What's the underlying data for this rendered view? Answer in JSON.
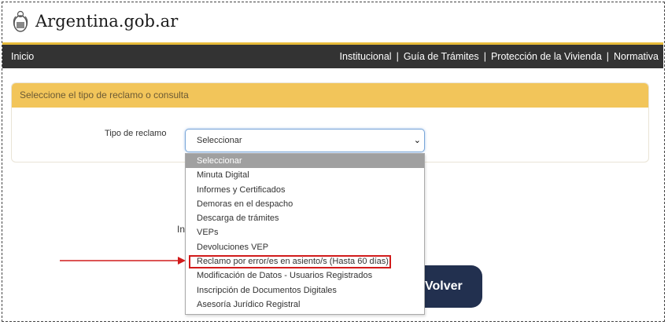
{
  "header": {
    "title": "Argentina.gob.ar",
    "logo_icon": "argentina-coat-of-arms-icon"
  },
  "nav": {
    "home": "Inicio",
    "items": [
      {
        "label": "Institucional"
      },
      {
        "label": "Guía de Trámites"
      },
      {
        "label": "Protección de la Vivienda"
      },
      {
        "label": "Normativa"
      }
    ],
    "separator": "|"
  },
  "panel": {
    "title": "Seleccione el tipo de reclamo o consulta"
  },
  "form": {
    "label": "Tipo de reclamo",
    "selected_value": "Seleccionar",
    "options": [
      "Seleccionar",
      "Minuta Digital",
      "Informes y Certificados",
      "Demoras en el despacho",
      "Descarga de trámites",
      "VEPs",
      "Devoluciones VEP",
      "Reclamo por error/es en asiento/s (Hasta 60 días)",
      "Modificación de Datos - Usuarios Registrados",
      "Inscripción de Documentos Digitales",
      "Asesoría Jurídico Registral"
    ],
    "highlighted_option_index": 7
  },
  "partial_text": "In",
  "back_button": {
    "label": "Volver"
  },
  "colors": {
    "accent_gold": "#f2c55a",
    "nav_dark": "#333333",
    "button_navy": "#22304f",
    "annotation_red": "#d11b1b"
  }
}
